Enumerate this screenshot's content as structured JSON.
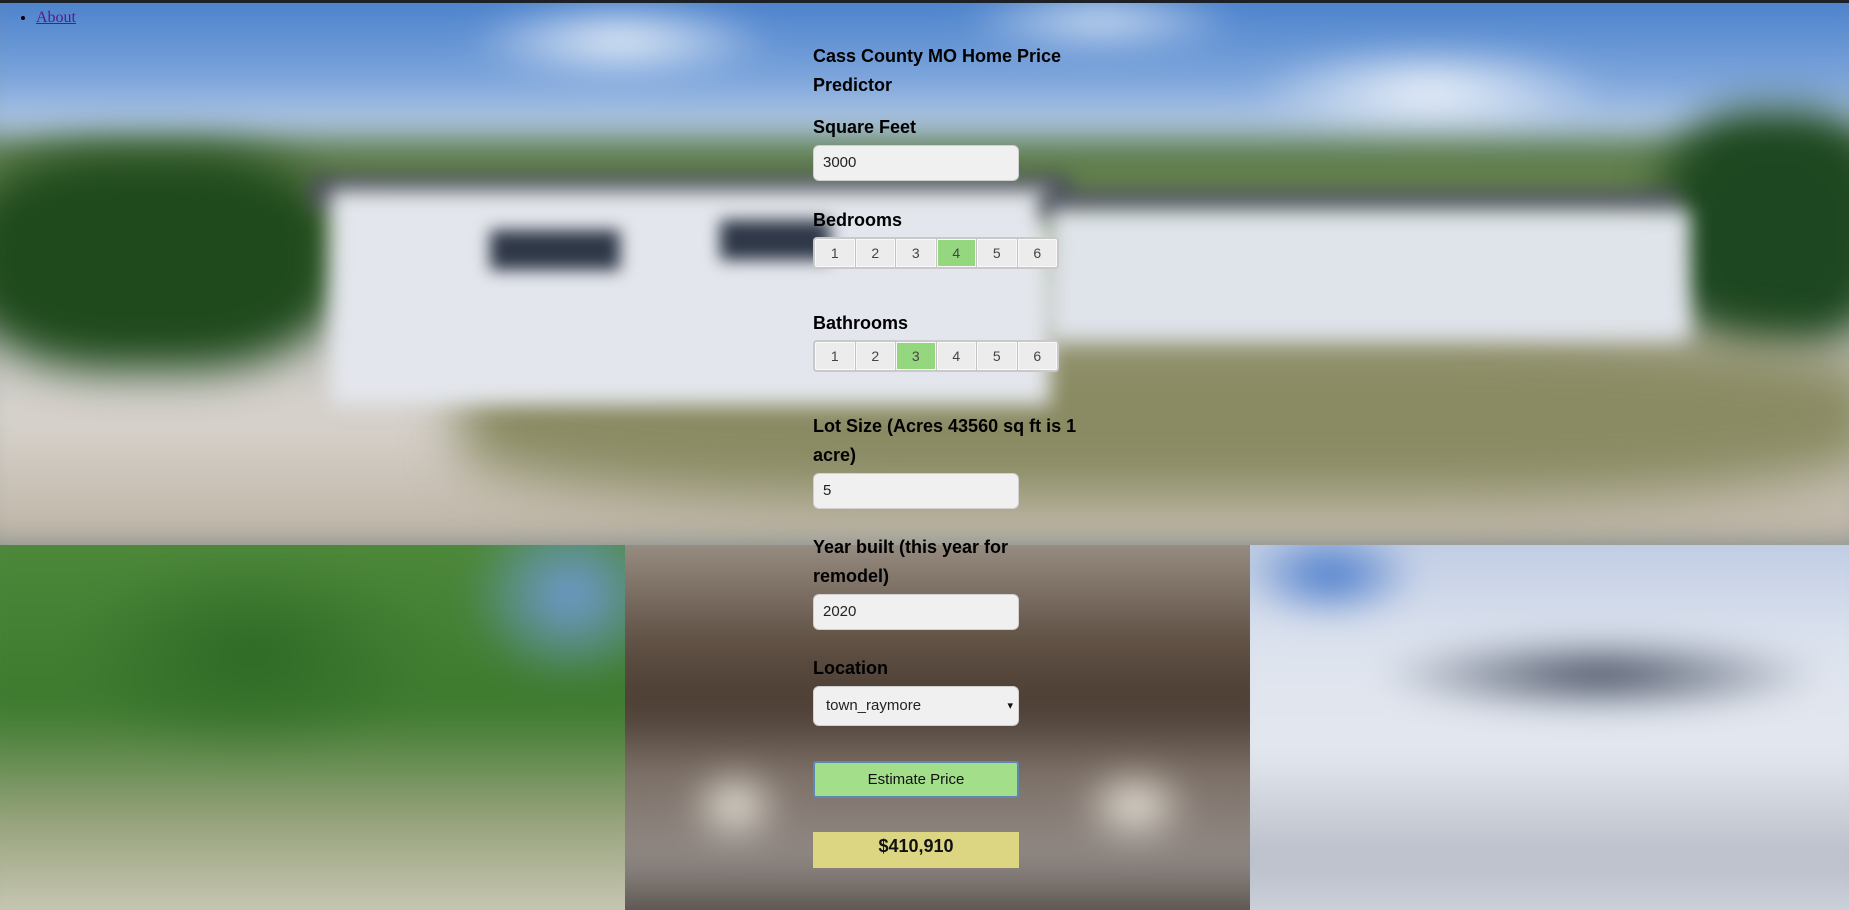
{
  "nav": {
    "items": [
      {
        "label": "About"
      }
    ]
  },
  "form": {
    "title": "Cass County MO Home Price Predictor",
    "square_feet": {
      "label": "Square Feet",
      "value": "3000"
    },
    "bedrooms": {
      "label": "Bedrooms",
      "options": [
        "1",
        "2",
        "3",
        "4",
        "5",
        "6"
      ],
      "selected": "4"
    },
    "bathrooms": {
      "label": "Bathrooms",
      "options": [
        "1",
        "2",
        "3",
        "4",
        "5",
        "6"
      ],
      "selected": "3"
    },
    "lot_size": {
      "label": "Lot Size (Acres 43560 sq ft is 1 acre)",
      "value": "5"
    },
    "year_built": {
      "label": "Year built (this year for remodel)",
      "value": "2020"
    },
    "location": {
      "label": "Location",
      "selected": "town_raymore",
      "caret": "▾"
    },
    "submit_label": "Estimate Price",
    "result": "$410,910"
  },
  "colors": {
    "selected_option": "#94d77e",
    "button": "#a3df8b",
    "result_bg": "#dcd682",
    "link": "#551a8b"
  }
}
